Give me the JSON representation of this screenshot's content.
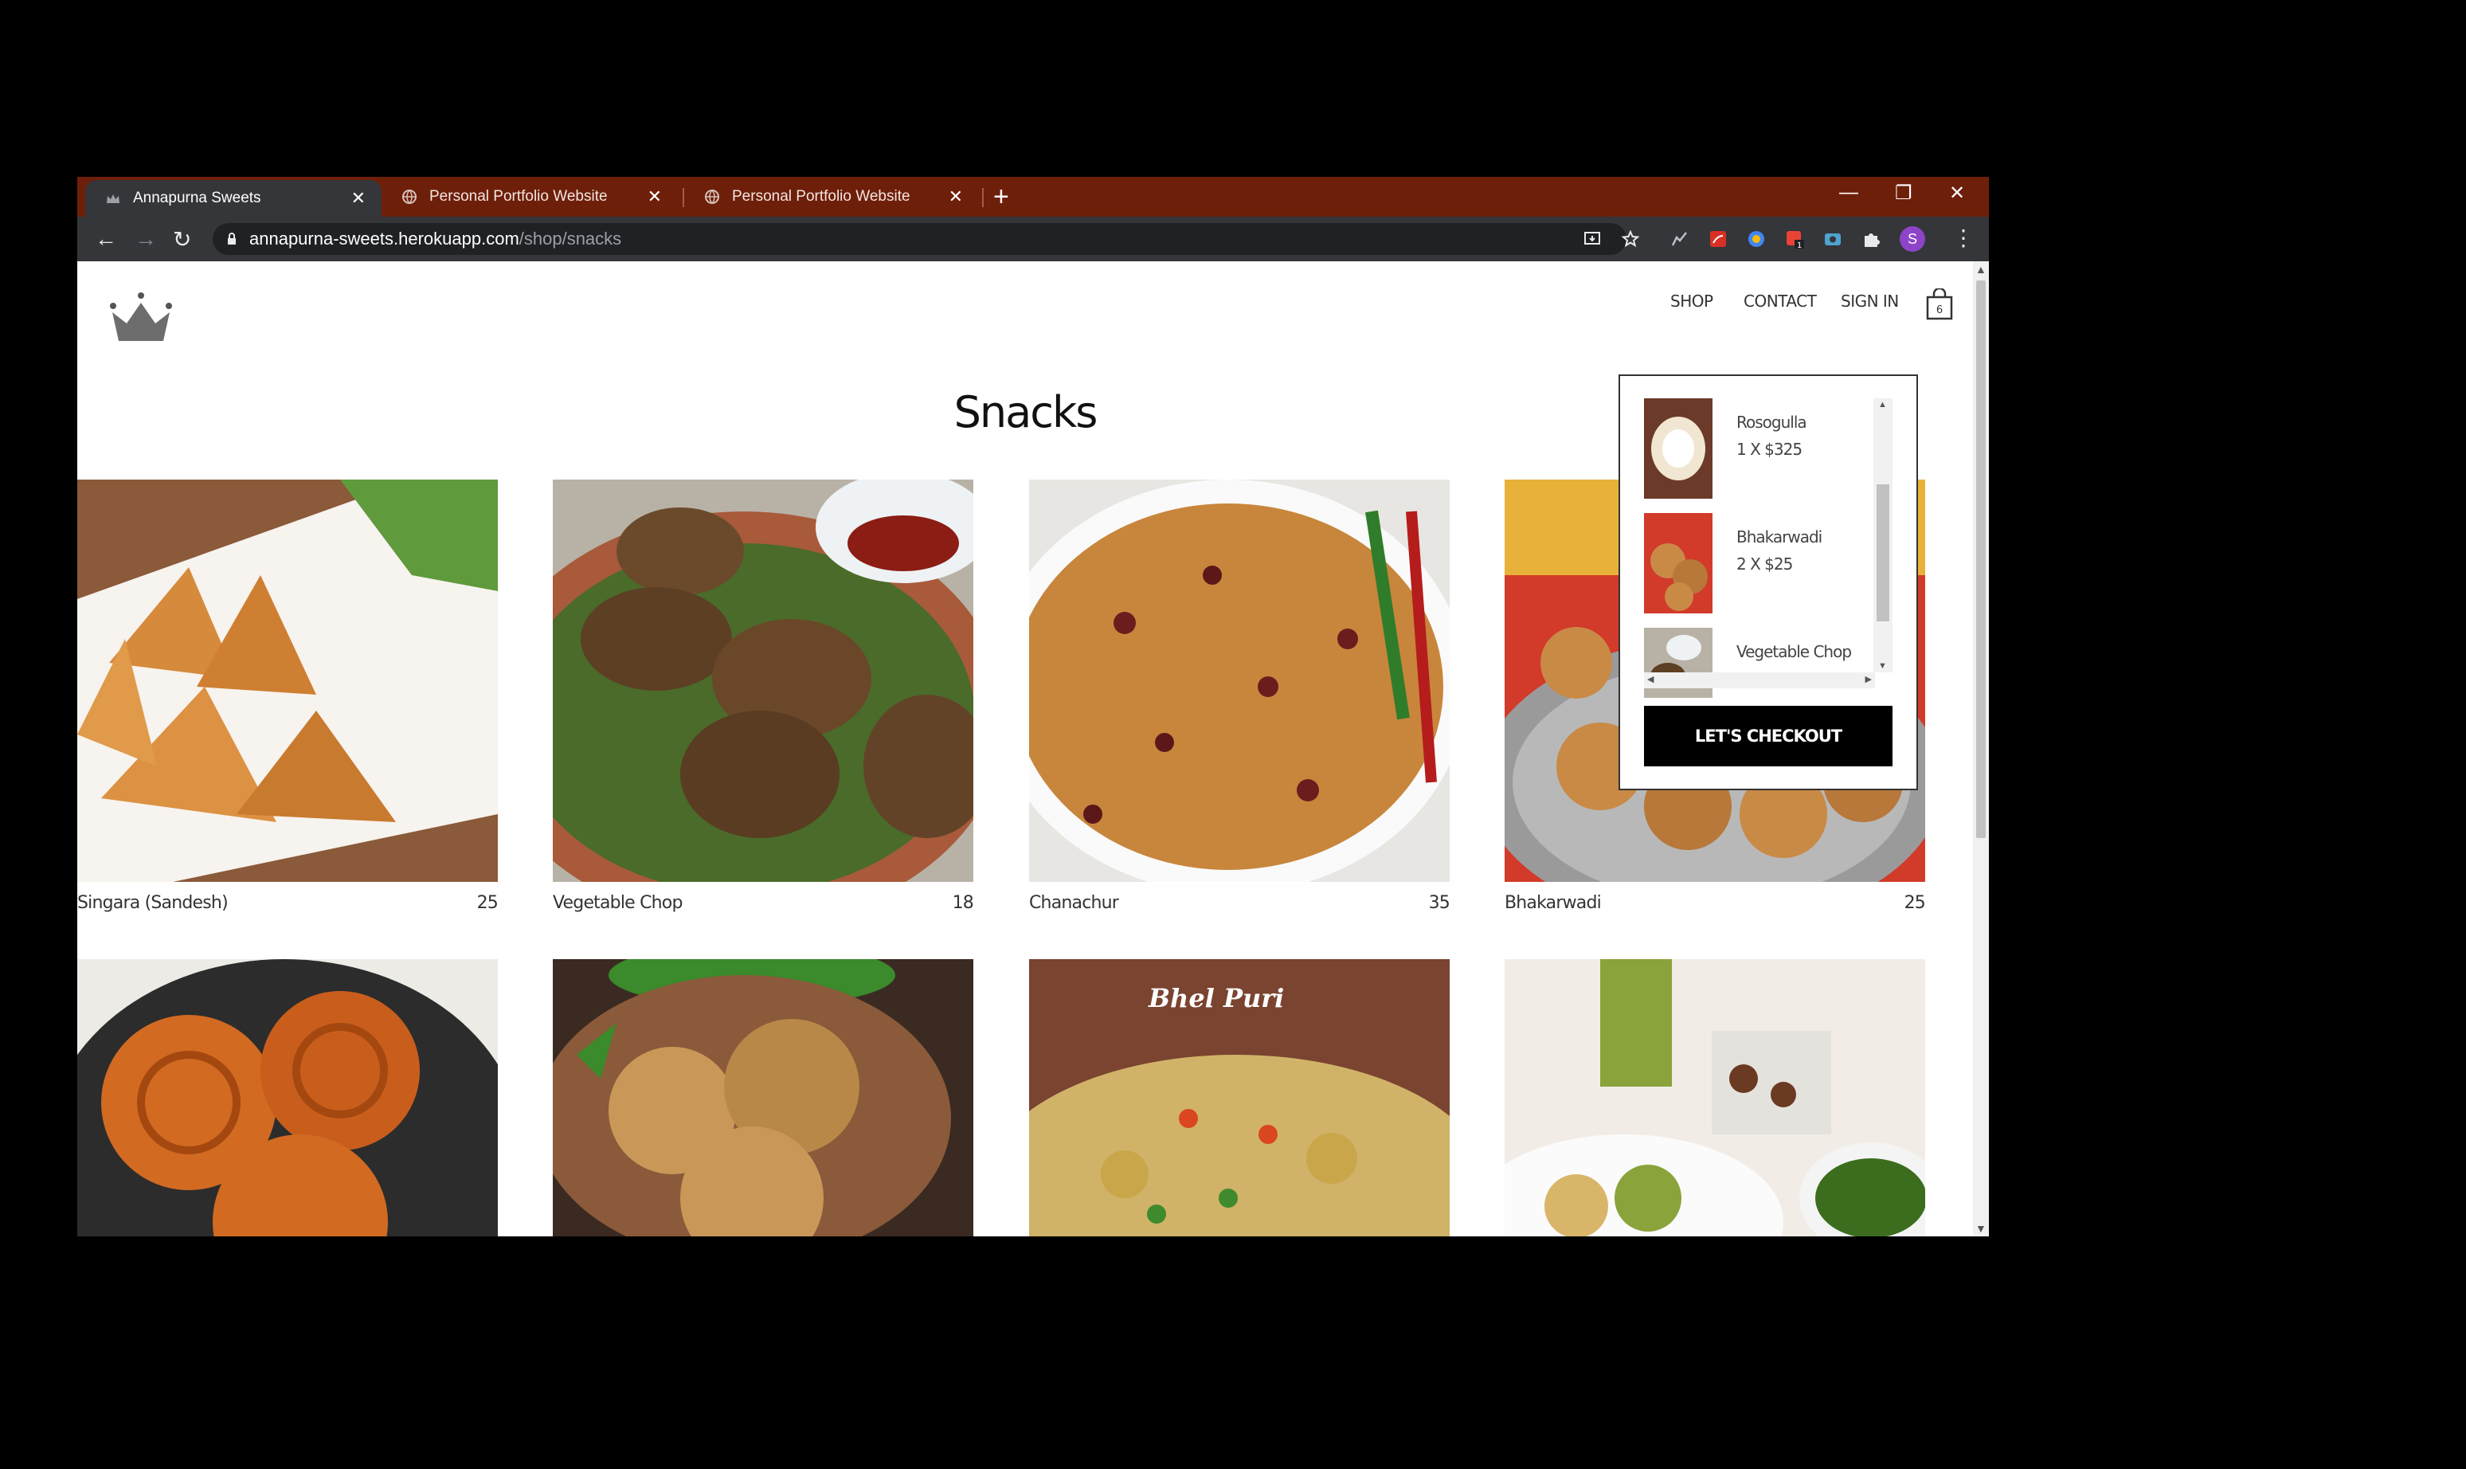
{
  "browser": {
    "tabs": [
      {
        "title": "Annapurna Sweets",
        "active": true
      },
      {
        "title": "Personal Portfolio Website",
        "active": false
      },
      {
        "title": "Personal Portfolio Website",
        "active": false
      }
    ],
    "url_host": "annapurna-sweets.herokuapp.com",
    "url_path": "/shop/snacks",
    "profile_initial": "S",
    "extension_badge": "1"
  },
  "nav": {
    "shop": "SHOP",
    "contact": "CONTACT",
    "signin": "SIGN IN",
    "cart_count": "6"
  },
  "page": {
    "title": "Snacks"
  },
  "products": [
    {
      "name": "Singara (Sandesh)",
      "price": "25"
    },
    {
      "name": "Vegetable Chop",
      "price": "18"
    },
    {
      "name": "Chanachur",
      "price": "35"
    },
    {
      "name": "Bhakarwadi",
      "price": "25"
    },
    {
      "name": "",
      "price": ""
    },
    {
      "name": "",
      "price": ""
    },
    {
      "name": "",
      "price": "",
      "image_caption": "Bhel Puri"
    },
    {
      "name": "",
      "price": ""
    }
  ],
  "cart": {
    "items": [
      {
        "name": "Rosogulla",
        "qty": "1 X $325"
      },
      {
        "name": "Bhakarwadi",
        "qty": "2 X $25"
      },
      {
        "name": "Vegetable Chop",
        "qty": ""
      }
    ],
    "checkout_label": "LET'S CHECKOUT"
  },
  "colors": {
    "tabstrip": "#6e1f0a",
    "toolbar": "#35363a",
    "checkout_bg": "#000000"
  }
}
